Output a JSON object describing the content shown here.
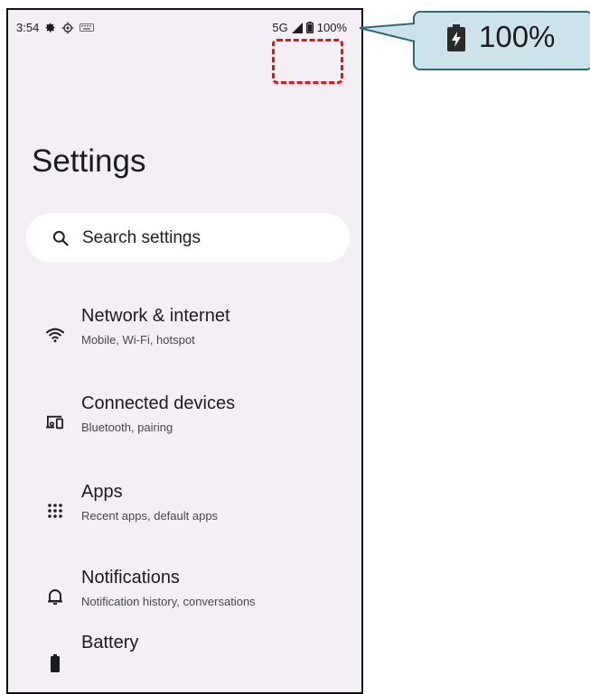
{
  "status_bar": {
    "time": "3:54",
    "network": "5G",
    "battery": "100%"
  },
  "callout": {
    "battery_label": "100%"
  },
  "settings": {
    "title": "Settings",
    "search_placeholder": "Search settings",
    "items": [
      {
        "title": "Network & internet",
        "subtitle": "Mobile, Wi-Fi, hotspot",
        "icon": "wifi-icon"
      },
      {
        "title": "Connected devices",
        "subtitle": "Bluetooth, pairing",
        "icon": "devices-icon"
      },
      {
        "title": "Apps",
        "subtitle": "Recent apps, default apps",
        "icon": "apps-grid-icon"
      },
      {
        "title": "Notifications",
        "subtitle": "Notification history, conversations",
        "icon": "bell-icon"
      },
      {
        "title": "Battery",
        "subtitle": "",
        "icon": "battery-icon"
      }
    ]
  },
  "colors": {
    "background": "#f4eff4",
    "callout_fill": "#cde3ec",
    "callout_border": "#2e6b7a",
    "highlight": "#e0141a"
  }
}
